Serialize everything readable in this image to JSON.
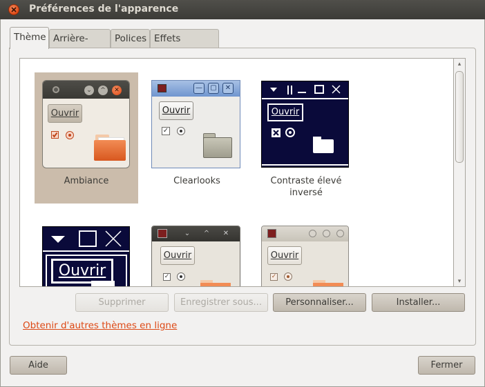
{
  "window": {
    "title": "Préférences de l'apparence"
  },
  "tabs": [
    {
      "label": "Thème"
    },
    {
      "label": "Arrière-plan"
    },
    {
      "label": "Polices"
    },
    {
      "label": "Effets visuels"
    }
  ],
  "preview_button_label": "Ouvrir",
  "themes": [
    {
      "name": "Ambiance",
      "selected": true
    },
    {
      "name": "Clearlooks",
      "selected": false
    },
    {
      "name_line1": "Contraste élevé",
      "name_line2": "inversé",
      "selected": false
    }
  ],
  "actions": {
    "delete": "Supprimer",
    "save_as": "Enregistrer sous...",
    "customize": "Personnaliser...",
    "install": "Installer..."
  },
  "more_themes_link": "Obtenir d'autres thèmes en ligne",
  "footer": {
    "help": "Aide",
    "close": "Fermer"
  },
  "colors": {
    "accent": "#dd4814",
    "selection": "#cbbcab",
    "titlebar": "#3c3b37"
  },
  "icons": [
    "close-icon",
    "folder-icon",
    "checkbox-icon",
    "radio-icon",
    "minimize-icon",
    "maximize-icon"
  ]
}
